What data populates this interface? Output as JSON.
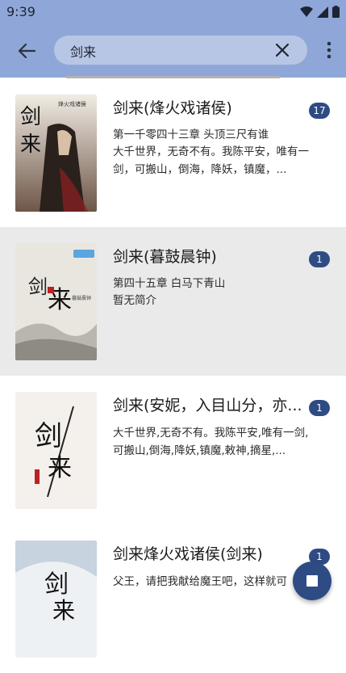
{
  "status_bar": {
    "time": "9:39",
    "icons": [
      "settings-icon",
      "wifi-icon",
      "signal-icon",
      "battery-icon"
    ]
  },
  "toolbar": {
    "search_value": "剑来",
    "back_icon": "arrow-left-icon",
    "clear_icon": "close-icon",
    "more_icon": "more-vert-icon"
  },
  "colors": {
    "primary": "#8fa7d8",
    "search_bg": "#b8c6e6",
    "accent": "#2f4b84",
    "selected_row": "#eaeaea"
  },
  "results": [
    {
      "title": "剑来(烽火戏诸侯)",
      "badge": "17",
      "latest_chapter": "第一千零四十三章 头顶三尺有谁",
      "intro": "大千世界，无奇不有。我陈平安，唯有一剑，可搬山，倒海，降妖，镇魔，...",
      "cover_text": "剑来",
      "cover_caption": "烽火戏诸侯",
      "selected": false
    },
    {
      "title": "剑来(暮鼓晨钟)",
      "badge": "1",
      "latest_chapter": "第四十五章 白马下青山",
      "intro": "暂无简介",
      "cover_text": "剑来",
      "cover_caption": "暮鼓晨钟",
      "selected": true
    },
    {
      "title": "剑来(安妮，入目山分，亦...",
      "badge": "1",
      "latest_chapter": "",
      "intro": "大千世界,无奇不有。我陈平安,唯有一剑,可搬山,倒海,降妖,镇魔,敕神,摘星,...",
      "cover_text": "剑来",
      "cover_caption": "",
      "selected": false
    },
    {
      "title": "剑来烽火戏诸侯(剑来)",
      "badge": "1",
      "latest_chapter": "",
      "intro": "父王，请把我献给魔王吧，这样就可",
      "cover_text": "剑来",
      "cover_caption": "",
      "selected": false
    }
  ],
  "fab": {
    "icon": "stop-icon"
  }
}
